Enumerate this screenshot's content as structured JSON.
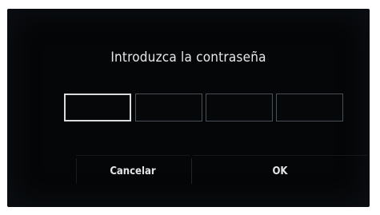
{
  "dialog": {
    "title": "Introduzca la contraseña",
    "pin": {
      "digits": [
        "",
        "",
        "",
        ""
      ],
      "active_index": 0
    },
    "buttons": {
      "cancel_label": "Cancelar",
      "ok_label": "OK"
    }
  }
}
